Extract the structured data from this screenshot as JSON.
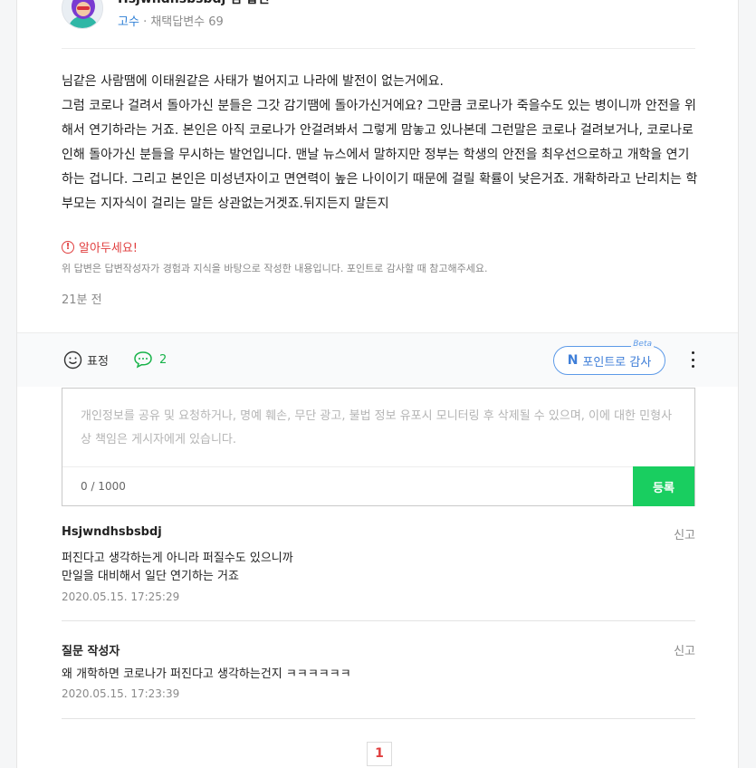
{
  "author": {
    "name": "Hsjwndhsbsbdj 님 답변",
    "rank": "고수",
    "separator": "·",
    "adopted": "채택답변수 69"
  },
  "answer": {
    "paragraphs": [
      "님같은 사람땜에 이태원같은 사태가 벌어지고 나라에 발전이 없는거에요.",
      "그럼 코로나 걸려서 돌아가신 분들은 그갓 감기땜에 돌아가신거에요? 그만큼 코로나가 죽을수도 있는 병이니까 안전을 위해서 연기하라는 거죠. 본인은 아직 코로나가 안걸려봐서 그렇게 맘놓고 있나본데 그런말은 코로나 걸려보거나, 코로나로인해 돌아가신 분들을 무시하는 발언입니다. 맨날 뉴스에서 말하지만 정부는 학생의 안전을 최우선으로하고 개학을 연기하는 겁니다. 그리고 본인은 미성년자이고 면연력이 높은 나이이기 때문에 걸릴 확률이 낮은거죠. 개확하라고 난리치는 학부모는 지자식이 걸리는 말든 상관없는거겟죠.뒤지든지 말든지"
    ],
    "notice_title": "알아두세요!",
    "notice_desc": "위 답변은 답변작성자가 경험과 지식을 바탕으로 작성한 내용입니다. 포인트로 감사할 때 참고해주세요.",
    "time": "21분 전"
  },
  "actions": {
    "react_label": "표정",
    "comment_count": "2",
    "points_label": "포인트로 감사",
    "points_icon": "N",
    "beta": "Beta"
  },
  "comment_form": {
    "placeholder": "개인정보를 공유 및 요청하거나, 명예 훼손, 무단 광고, 불법 정보 유포시 모니터링 후 삭제될 수 있으며, 이에 대한 민형사상 책임은 게시자에게 있습니다.",
    "count": "0 / 1000",
    "submit_label": "등록"
  },
  "comments": [
    {
      "author": "Hsjwndhsbsbdj",
      "report": "신고",
      "lines": [
        "퍼진다고 생각하는게 아니라 퍼질수도 있으니까",
        "만일을 대비해서 일단 연기하는 거죠"
      ],
      "time": "2020.05.15. 17:25:29"
    },
    {
      "author": "질문 작성자",
      "report": "신고",
      "lines": [
        "왜 개학하면 코로나가 퍼진다고 생각하는건지 ㅋㅋㅋㅋㅋㅋ"
      ],
      "time": "2020.05.15. 17:23:39"
    }
  ],
  "pagination": {
    "current": "1"
  },
  "colors": {
    "accent_green": "#19ce60",
    "comment_green": "#19b34a",
    "points_blue": "#3e7ed8",
    "notice_red": "#e03e3e"
  }
}
